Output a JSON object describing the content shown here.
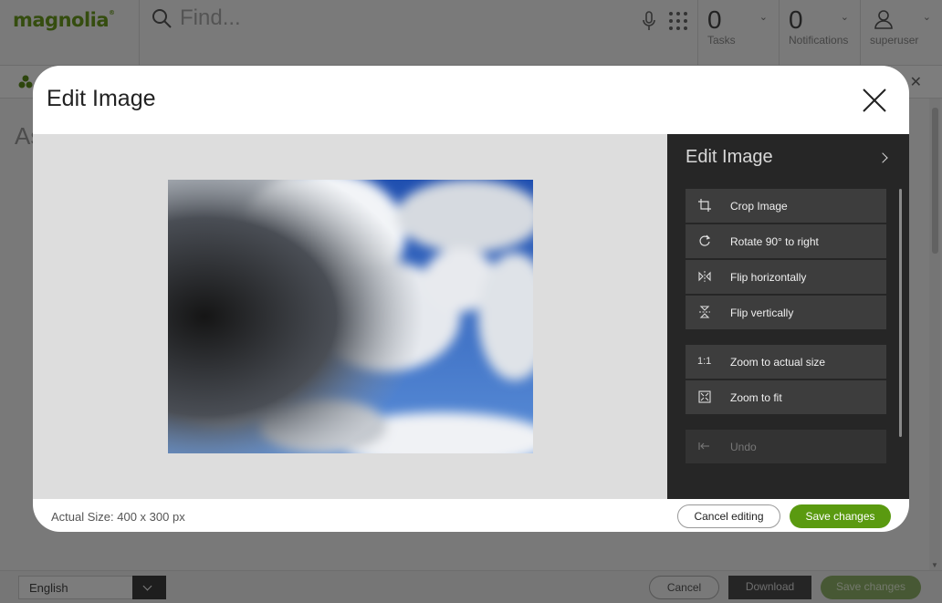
{
  "app": {
    "logo": "magnolia",
    "search_placeholder": "Find...",
    "tasks": {
      "count": "0",
      "label": "Tasks"
    },
    "notifications": {
      "count": "0",
      "label": "Notifications"
    },
    "user": {
      "label": "superuser"
    },
    "bg_title": "As",
    "footer": {
      "language": "English",
      "cancel": "Cancel",
      "download": "Download",
      "save": "Save changes"
    }
  },
  "dialog": {
    "title": "Edit Image",
    "panel": {
      "title": "Edit Image",
      "actions": [
        {
          "label": "Crop Image",
          "icon": "crop-icon"
        },
        {
          "label": "Rotate 90° to right",
          "icon": "rotate-right-icon"
        },
        {
          "label": "Flip horizontally",
          "icon": "flip-horizontal-icon"
        },
        {
          "label": "Flip vertically",
          "icon": "flip-vertical-icon"
        },
        {
          "label": "Zoom to actual size",
          "icon": "zoom-actual-icon",
          "icon_text": "1:1"
        },
        {
          "label": "Zoom to fit",
          "icon": "zoom-fit-icon"
        },
        {
          "label": "Undo",
          "icon": "undo-icon",
          "disabled": true
        }
      ]
    },
    "footer": {
      "actual_size": "Actual Size: 400 x 300 px",
      "cancel": "Cancel editing",
      "save": "Save changes"
    }
  },
  "colors": {
    "brand_green": "#6a9a1f",
    "save_green": "#5a9a10",
    "panel_bg": "#262626"
  }
}
